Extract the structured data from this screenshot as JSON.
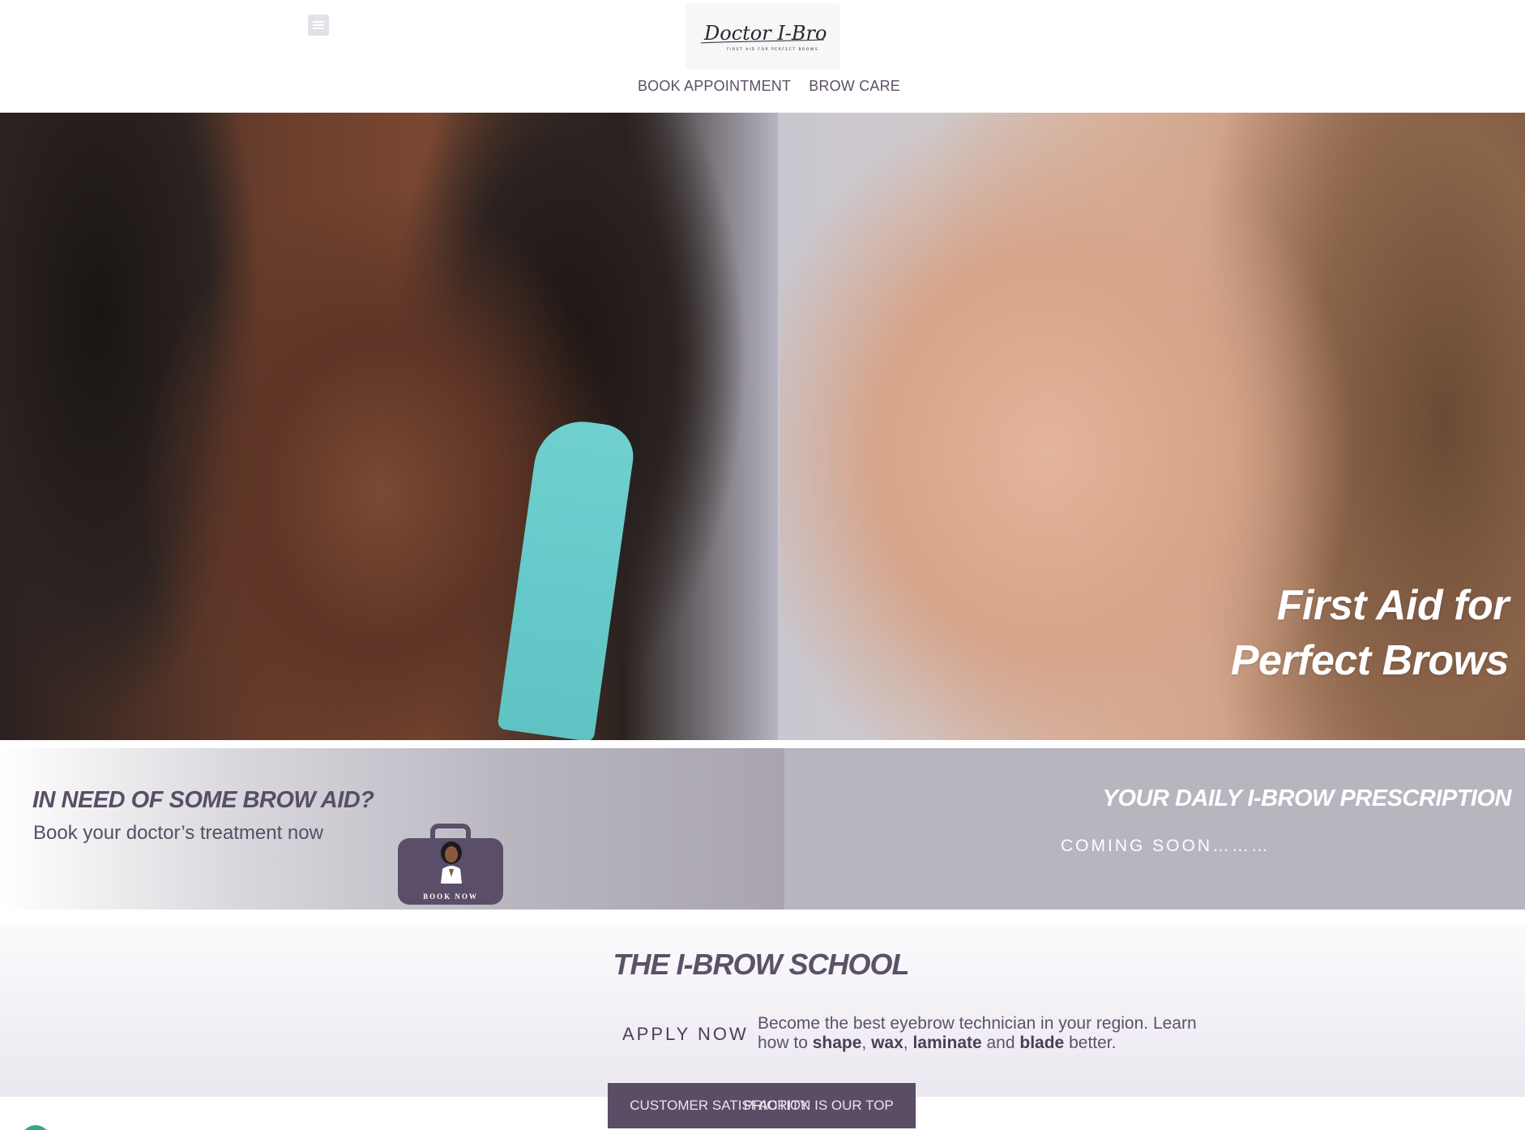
{
  "header": {
    "logo_text": "Doctor I-Brow",
    "logo_tagline": "FIRST AID FOR PERFECT BROWS",
    "nav": [
      {
        "label": "BOOK APPOINTMENT"
      },
      {
        "label": "BROW CARE"
      }
    ]
  },
  "hero": {
    "title_line1": "First Aid for",
    "title_line2": "Perfect Brows"
  },
  "promo": {
    "left_title": "IN NEED OF SOME BROW AID?",
    "left_subtitle": "Book your doctor’s treatment now",
    "book_now_label": "BOOK NOW",
    "right_title": "YOUR DAILY I-BROW PRESCRIPTION",
    "right_subtitle": "COMING SOON………"
  },
  "school": {
    "title": "THE I-BROW SCHOOL",
    "apply_label": "APPLY NOW",
    "desc_part1": "Become the best eyebrow technician in your region. Learn how to ",
    "desc_shape": "shape",
    "desc_sep1": ", ",
    "desc_wax": "wax",
    "desc_sep2": ", ",
    "desc_laminate": "laminate",
    "desc_and": " and ",
    "desc_blade": "blade",
    "desc_end": " better."
  },
  "banner": {
    "text_a": "CUSTOMER SATISFACTION IS OUR TOP",
    "text_b": "PRIORITY"
  },
  "colors": {
    "brand_purple": "#5a4d66",
    "promo_right_bg": "#b8b5bf",
    "chat_green": "#37a980"
  },
  "icons": {
    "menu": "hamburger-icon",
    "book": "briefcase-icon",
    "chat": "chat-icon"
  }
}
